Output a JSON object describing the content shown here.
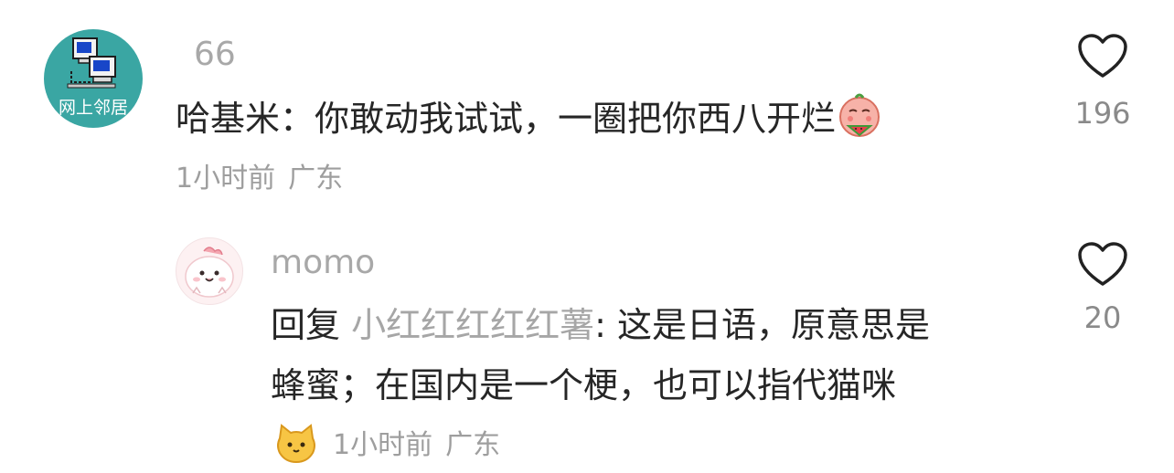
{
  "comment": {
    "avatar_caption": "网上邻居",
    "username": "66",
    "text": "哈基米：你敢动我试试，一圈把你西八开烂",
    "emoji_icon": "watermelon-face-emoji",
    "time": "1小时前",
    "location": "广东",
    "like_icon": "heart-outline-icon",
    "likes": "196"
  },
  "reply": {
    "username": "momo",
    "reply_label": "回复",
    "mention": "小红红红红红薯",
    "line1_text": ": 这是日语，原意思是",
    "line2_text": "蜂蜜；在国内是一个梗，也可以指代猫咪",
    "emoji_icon": "cat-face-emoji",
    "time": "1小时前",
    "location": "广东",
    "like_icon": "heart-outline-icon",
    "likes": "20"
  },
  "colors": {
    "avatar_teal": "#3aa6a3",
    "text_primary": "#262626",
    "text_secondary": "#a8a8a8"
  }
}
